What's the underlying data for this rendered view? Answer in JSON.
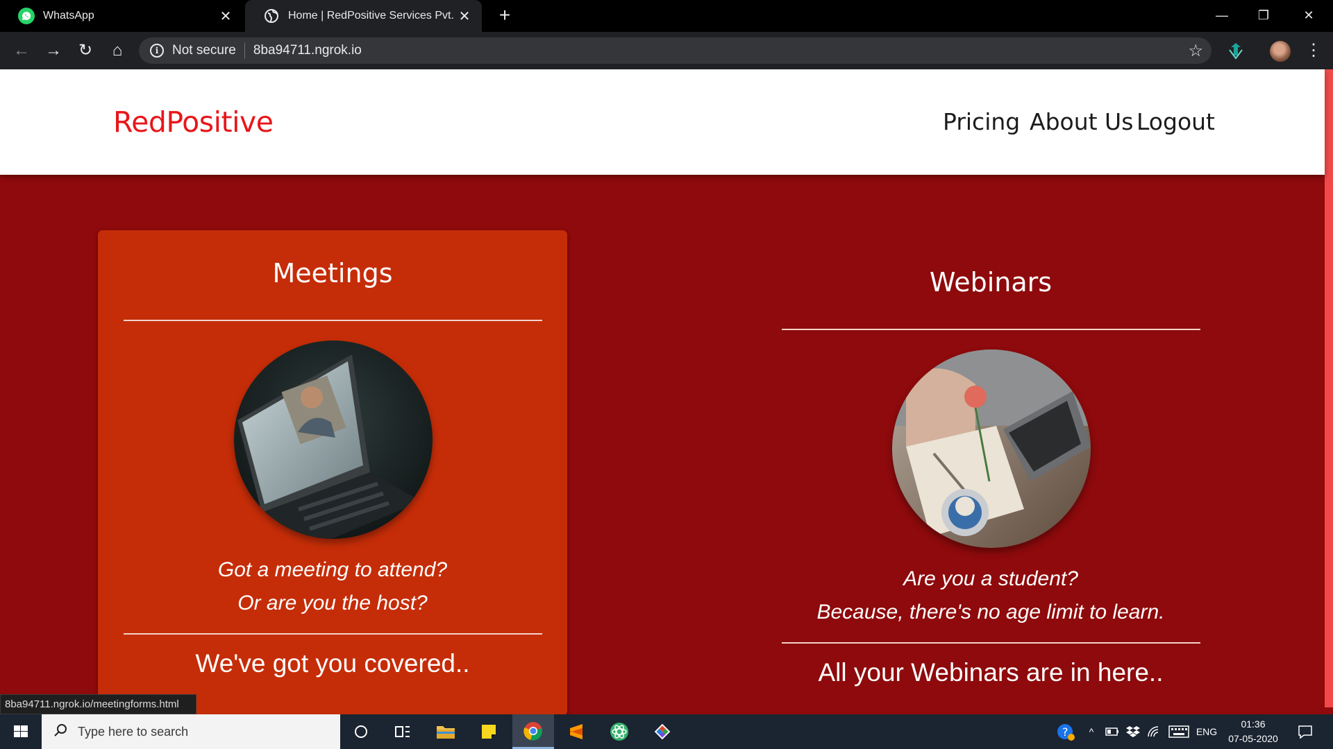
{
  "browser": {
    "tabs": [
      {
        "title": "WhatsApp",
        "icon": "whatsapp-icon",
        "active": false
      },
      {
        "title": "Home | RedPositive Services Pvt. Ltd.",
        "icon": "globe-icon",
        "active": true
      }
    ],
    "omnibox": {
      "security_label": "Not secure",
      "url": "8ba94711.ngrok.io"
    },
    "status_url": "8ba94711.ngrok.io/meetingforms.html"
  },
  "site": {
    "brand": "RedPositive",
    "nav": [
      "Pricing",
      "About Us",
      "Logout"
    ]
  },
  "cards": {
    "meetings": {
      "title": "Meetings",
      "question_line1": "Got a meeting to attend?",
      "question_line2": "Or are you the host?",
      "tagline": "We've got you covered.."
    },
    "webinars": {
      "title": "Webinars",
      "question_line1": "Are you a student?",
      "question_line2": "Because, there's no age limit to learn.",
      "tagline": "All your Webinars are in here.."
    }
  },
  "taskbar": {
    "search_placeholder": "Type here to search",
    "language": "ENG",
    "time": "01:36",
    "date": "07-05-2020"
  },
  "colors": {
    "brand_red": "#e8161a",
    "page_bg": "#8e0a0c",
    "card_bg": "#c52d08"
  }
}
